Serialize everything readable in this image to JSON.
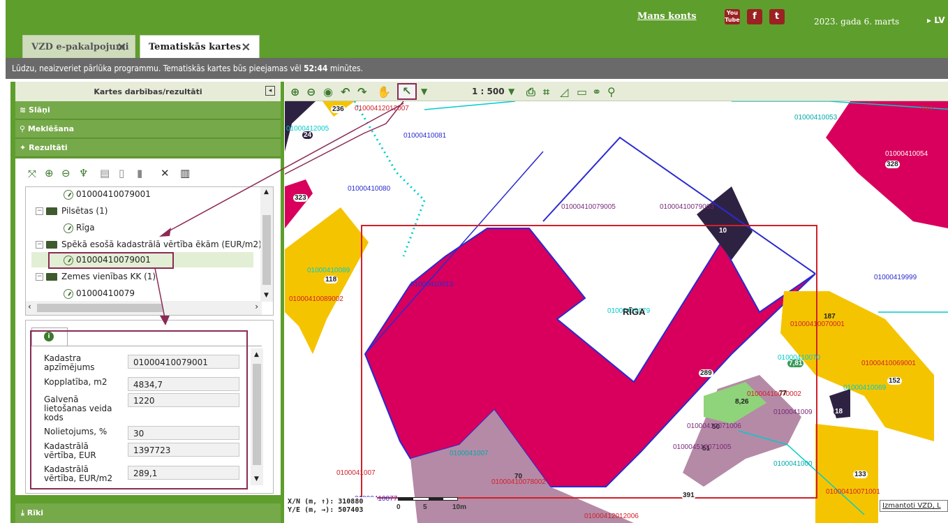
{
  "header": {
    "account_link": "Mans konts",
    "date": "2023. gada 6. marts",
    "lang": "LV",
    "social": [
      "You Tube",
      "f",
      "t"
    ]
  },
  "tabs": [
    {
      "label": "VZD e-pakalpojumi",
      "active": false
    },
    {
      "label": "Tematiskās kartes",
      "active": true
    }
  ],
  "notice": {
    "prefix": "Lūdzu, neaizveriet pārlūka programmu. Tematiskās kartes būs pieejamas vēl ",
    "time": "52:44",
    "suffix": " minūtes."
  },
  "panel": {
    "title": "Kartes darbības/rezultāti",
    "sections": [
      "Slāņi",
      "Meklēšana",
      "Rezultāti"
    ],
    "bottom_section": "Rīki"
  },
  "tree": {
    "items": [
      {
        "type": "leaf",
        "label": "01000410079001"
      },
      {
        "type": "folder",
        "label": "Pilsētas (1)"
      },
      {
        "type": "leaf",
        "label": "Rīga"
      },
      {
        "type": "folder",
        "label": "Spēkā esošā kadastrālā vērtība ēkām (EUR/m2) ("
      },
      {
        "type": "leaf",
        "label": "01000410079001",
        "selected": true
      },
      {
        "type": "folder",
        "label": "Zemes vienības KK (1)"
      },
      {
        "type": "leaf",
        "label": "01000410079"
      }
    ]
  },
  "properties": [
    {
      "label": "Kadastra apzīmējums",
      "value": "01000410079001"
    },
    {
      "label": "Kopplatība, m2",
      "value": "4834,7"
    },
    {
      "label": "Galvenā lietošanas veida kods",
      "value": "1220"
    },
    {
      "label": "Nolietojums, %",
      "value": "30"
    },
    {
      "label": "Kadastrālā vērtība, EUR",
      "value": "1397723"
    },
    {
      "label": "Kadastrālā vērtība, EUR/m2",
      "value": "289,1"
    }
  ],
  "map": {
    "scale": "1 : 500",
    "city_label": "RĪGA",
    "coords_n": "X/N (m, ↑): 310880",
    "coords_e": "Y/E (m, →): 507403",
    "scale_labels": [
      "0",
      "5",
      "10m"
    ],
    "credit": "Izmantoti VZD, L",
    "labels": {
      "l1": "01000412012007",
      "l2": "01000410081",
      "l3": "01000410080",
      "l4": "01000410079005",
      "l5": "01000410013",
      "l6": "01000410089002",
      "l7": "01000410053",
      "l8": "01000410054",
      "l9": "01000419999",
      "l10": "01000410070001",
      "l11": "01000410069001",
      "l12": "01000410078002",
      "l13": "01000410071001",
      "l14": "01000412012006",
      "l15": "01000412005",
      "l16": "01000410079003",
      "l17": "0100041000",
      "l18": "01000410071006",
      "l19": "010004510071005",
      "l20": "01000410070002",
      "l21": "01000410089",
      "l22": "01000410079",
      "l23": "0100041007",
      "l24": "0100041007",
      "l25": "010",
      "l26": "01000410069",
      "l27": "01000410070",
      "l28": "0100041009",
      "l29": "01000410077"
    },
    "numbers": {
      "n1": "236",
      "n2": "24",
      "n3": "323",
      "n4": "328",
      "n5": "118",
      "n6": "289",
      "n7": "187",
      "n8": "152",
      "n9": "133",
      "n10": "70",
      "n11": "391",
      "n12": "7,81",
      "n13": "8,26",
      "n14": "18",
      "n15": "77",
      "n16": "50",
      "n17": "51",
      "n18": "10"
    }
  },
  "colors": {
    "green": "#5e9e2d",
    "magenta": "#d8005c",
    "yellow": "#f5c400",
    "mauve": "#b58aa6",
    "dark": "#2e2242",
    "annot": "#8b2a55"
  }
}
